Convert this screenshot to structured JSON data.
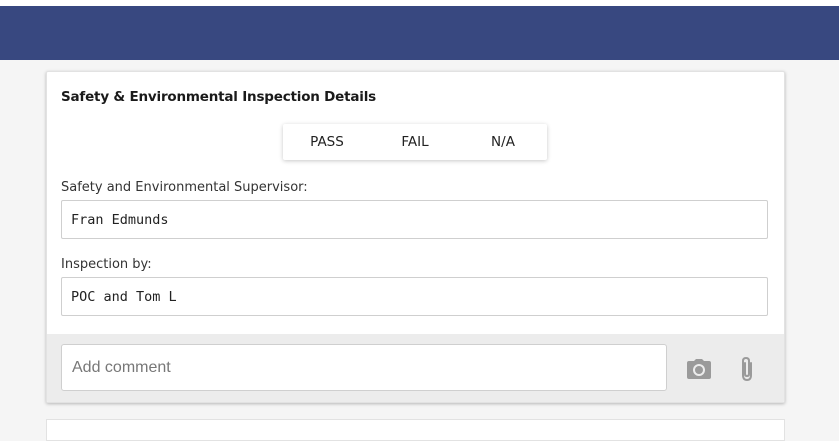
{
  "section": {
    "title": "Safety & Environmental Inspection Details"
  },
  "status_options": [
    {
      "label": "PASS"
    },
    {
      "label": "FAIL"
    },
    {
      "label": "N/A"
    }
  ],
  "fields": {
    "supervisor": {
      "label": "Safety and Environmental Supervisor:",
      "value": "Fran Edmunds"
    },
    "inspection_by": {
      "label": "Inspection by:",
      "value": "POC and Tom L"
    }
  },
  "comment": {
    "placeholder": "Add comment"
  },
  "icons": {
    "camera": "camera-icon",
    "attach": "paperclip-icon"
  },
  "colors": {
    "header": "#384880",
    "icon": "#9a9a9a"
  }
}
